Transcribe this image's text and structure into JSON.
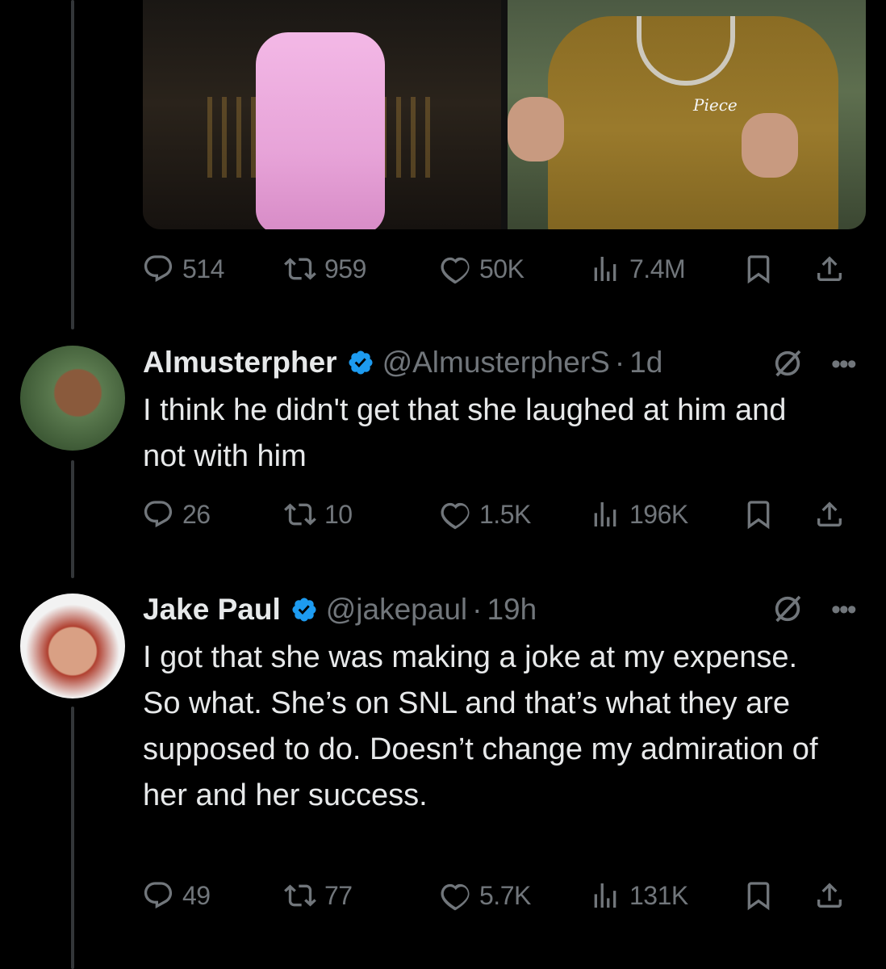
{
  "colors": {
    "background": "#000000",
    "text": "#e7e9ea",
    "muted": "#71767b",
    "verified": "#1d9bf0",
    "thread_line": "#333639"
  },
  "top_post": {
    "media_caption": "Piece",
    "actions": {
      "replies": "514",
      "retweets": "959",
      "likes": "50K",
      "views": "7.4M"
    }
  },
  "reply1": {
    "name": "Almusterpher",
    "handle": "@AlmusterpherS",
    "dot": "·",
    "time": "1d",
    "more": "•••",
    "text": "I think he didn't get that she laughed at him and not with him",
    "actions": {
      "replies": "26",
      "retweets": "10",
      "likes": "1.5K",
      "views": "196K"
    }
  },
  "reply2": {
    "name": "Jake Paul",
    "handle": "@jakepaul",
    "dot": "·",
    "time": "19h",
    "more": "•••",
    "text": "I got that she was making a joke at my expense.  So what. She’s on SNL and that’s what they are supposed to do. Doesn’t change my admiration of her and her success.",
    "actions": {
      "replies": "49",
      "retweets": "77",
      "likes": "5.7K",
      "views": "131K"
    }
  },
  "icons": [
    "reply-icon",
    "retweet-icon",
    "like-icon",
    "views-icon",
    "bookmark-icon",
    "share-icon",
    "verified-icon",
    "grok-icon",
    "more-icon"
  ]
}
